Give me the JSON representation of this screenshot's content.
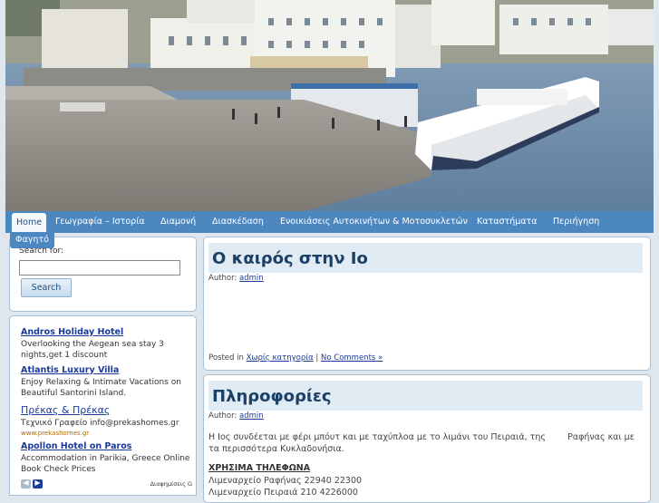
{
  "header": {
    "colors": {
      "sea": "#6f8fae",
      "pier": "#8c8a84",
      "buildings": "#ecece6",
      "nav": "#4d87c0"
    }
  },
  "nav": {
    "items": [
      "Home",
      "Γεωγραφία – Ιστορία",
      "Διαμονή",
      "Διασκέδαση",
      "Ενοικιάσεις Αυτοκινήτων & Μοτοσυκλετών",
      "Καταστήματα",
      "Περιήγηση",
      "Φαγητό"
    ]
  },
  "sidebar": {
    "search": {
      "label": "Search for:",
      "value": "",
      "button_label": "Search"
    },
    "ads": {
      "items": [
        {
          "title": "Andros Holiday Hotel",
          "text": "Overlooking the Aegean sea stay 3 nights,get 1 discount"
        },
        {
          "title": "Atlantis Luxury Villa",
          "text": "Enjoy Relaxing & Intimate Vacations on Beautiful Santorini Island."
        },
        {
          "title": "Πρέκας & Πρέκας",
          "text": "Τεχνικό Γραφείο info@prekashomes.gr",
          "url": "www.prekashomes.gr"
        },
        {
          "title": "Apollon Hotel on Paros",
          "text": "Accommodation in Parikia, Greece Online Book Check Prices"
        }
      ],
      "prev_icon": "chevron-left-icon",
      "next_icon": "chevron-right-icon",
      "by_label": "Διαφημίσεις G"
    }
  },
  "posts": [
    {
      "title": "Ο καιρός στην Ιο",
      "author_label": "Author:",
      "author": "admin",
      "posted_in_label": "Posted in",
      "category": "Χωρίς κατηγορία",
      "separator": "|",
      "comments": "No Comments »"
    },
    {
      "title": "Πληροφορίες",
      "author_label": "Author:",
      "author": "admin",
      "body": "Η Ιος συνδέεται με φέρι μπόυτ και με ταχύπλοα με το λιμάνι του Πειραιά, της        Ραφήνας και με τα περισσότερα Κυκλαδονήσια.",
      "phones_heading": "ΧΡΗΣΙΜΑ ΤΗΛΕΦΩΝΑ",
      "phones": [
        "Λιμεναρχείο Ραφήνας 22940 22300",
        "Λιμεναρχείο Πειραιά 210 4226000"
      ]
    }
  ]
}
